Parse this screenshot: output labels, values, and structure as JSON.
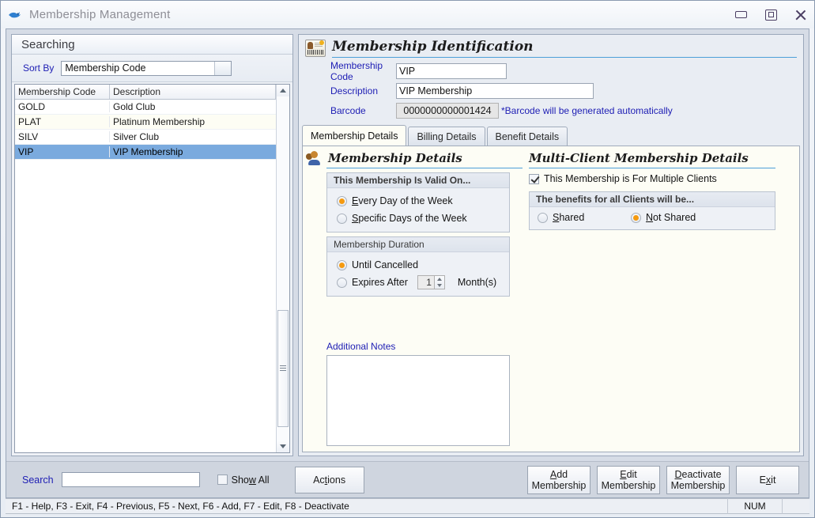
{
  "window": {
    "title": "Membership Management",
    "icon": "app-bird-icon",
    "controls": {
      "minimize": "minimize",
      "restore": "restore",
      "close": "close"
    }
  },
  "search_panel": {
    "header": "Searching",
    "sort_by_label": "Sort By",
    "sort_by_value": "Membership Code",
    "columns": [
      "Membership Code",
      "Description"
    ],
    "rows": [
      {
        "code": "GOLD",
        "description": "Gold Club"
      },
      {
        "code": "PLAT",
        "description": "Platinum Membership"
      },
      {
        "code": "SILV",
        "description": "Silver Club"
      },
      {
        "code": "VIP",
        "description": "VIP Membership"
      }
    ],
    "selected_row_index": 3
  },
  "identification": {
    "title": "Membership Identification",
    "fields": {
      "code_label": "Membership Code",
      "code_value": "VIP",
      "description_label": "Description",
      "description_value": "VIP Membership",
      "barcode_label": "Barcode",
      "barcode_value": "0000000000001424",
      "barcode_note": "*Barcode will be generated automatically"
    }
  },
  "tabs": [
    {
      "label": "Membership Details",
      "active": true
    },
    {
      "label": "Billing Details",
      "active": false
    },
    {
      "label": "Benefit Details",
      "active": false
    }
  ],
  "membership_details": {
    "section_title": "Membership Details",
    "valid_on": {
      "group_title": "This Membership Is Valid On...",
      "options": [
        {
          "label_pre": "",
          "accel": "E",
          "label_post": "very Day of the Week",
          "selected": true
        },
        {
          "label_pre": "",
          "accel": "S",
          "label_post": "pecific Days of the Week",
          "selected": false
        }
      ]
    },
    "duration": {
      "group_title": "Membership Duration",
      "options": [
        {
          "label": "Until Cancelled",
          "selected": true
        },
        {
          "label": "Expires After",
          "selected": false
        }
      ],
      "months_value": "1",
      "months_suffix": "Month(s)"
    },
    "notes_label": "Additional Notes",
    "notes_value": ""
  },
  "multi_client": {
    "section_title": "Multi-Client Membership Details",
    "checkbox_label": "This Membership is For Multiple Clients",
    "checkbox_checked": true,
    "benefits": {
      "group_title": "The benefits for all Clients will be...",
      "options": [
        {
          "accel": "S",
          "label_post": "hared",
          "selected": false
        },
        {
          "accel": "N",
          "label_post": "ot Shared",
          "selected": true
        }
      ]
    }
  },
  "bottom_bar": {
    "search_label": "Search",
    "search_value": "",
    "show_all_pre": "Sho",
    "show_all_accel": "w",
    "show_all_post": " All",
    "show_all_checked": false,
    "actions_pre": "Ac",
    "actions_accel": "t",
    "actions_post": "ions",
    "buttons": [
      {
        "accel": "A",
        "line1_post": "dd",
        "line2": "Membership"
      },
      {
        "accel": "E",
        "line1_post": "dit",
        "line2": "Membership"
      },
      {
        "accel": "D",
        "line1_post": "eactivate",
        "line2": "Membership"
      }
    ],
    "exit_pre": "E",
    "exit_accel": "x",
    "exit_post": "it"
  },
  "status_bar": {
    "hints": "F1 - Help, F3 - Exit, F4 - Previous, F5 - Next, F6 - Add, F7 - Edit, F8 - Deactivate",
    "num": "NUM",
    "extra": ""
  },
  "colors": {
    "accent_blue": "#1d1db4",
    "rule_blue": "#4c9fd8",
    "selection": "#7aaade",
    "radio_fill": "#f59a10"
  }
}
